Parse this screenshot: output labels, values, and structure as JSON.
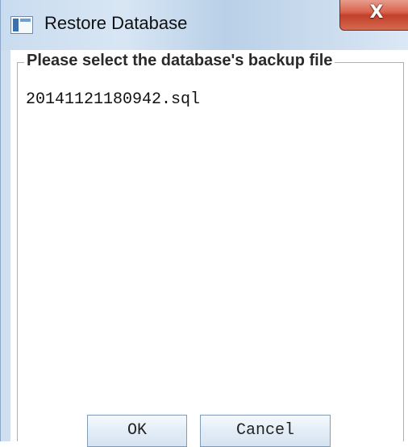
{
  "window": {
    "title": "Restore Database",
    "close_glyph": "X"
  },
  "group": {
    "legend": "Please select the database's backup file"
  },
  "file_list": {
    "items": [
      "20141121180942.sql"
    ]
  },
  "buttons": {
    "ok_label": "OK",
    "cancel_label": "Cancel"
  },
  "icons": {
    "app": "application-window-icon",
    "close": "close-icon"
  },
  "colors": {
    "titlebar": "#cfdff0",
    "close_button": "#c2402a",
    "content_background": "#ffffff",
    "button_border": "#7f9db9"
  }
}
